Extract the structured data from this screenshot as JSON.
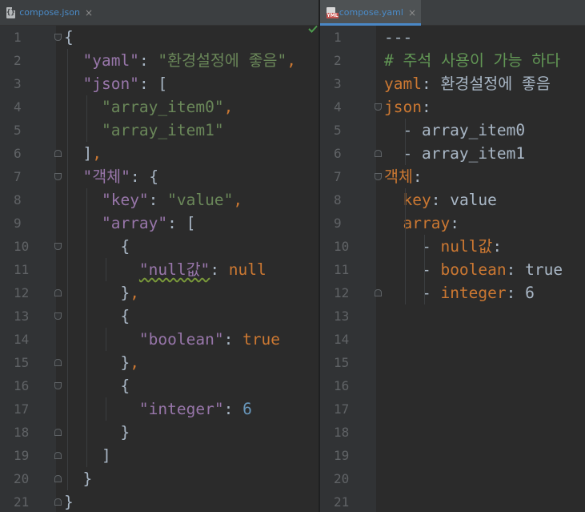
{
  "tabs": {
    "left": {
      "label": "compose.json",
      "icon": "json-file-icon",
      "close": "×"
    },
    "right": {
      "label": "compose.yaml",
      "icon": "yaml-file-icon",
      "close": "×",
      "active": true
    }
  },
  "left_editor": {
    "line_numbers": [
      "1",
      "2",
      "3",
      "4",
      "5",
      "6",
      "7",
      "8",
      "9",
      "10",
      "11",
      "12",
      "13",
      "14",
      "15",
      "16",
      "17",
      "18",
      "19",
      "20",
      "21"
    ],
    "lines": [
      [
        {
          "t": "p",
          "v": "{"
        }
      ],
      [
        {
          "t": "p",
          "v": "  "
        },
        {
          "t": "k",
          "v": "\"yaml\""
        },
        {
          "t": "p",
          "v": ": "
        },
        {
          "t": "s",
          "v": "\"환경설정에 좋음\""
        },
        {
          "t": "b",
          "v": ","
        }
      ],
      [
        {
          "t": "p",
          "v": "  "
        },
        {
          "t": "k",
          "v": "\"json\""
        },
        {
          "t": "p",
          "v": ": ["
        }
      ],
      [
        {
          "t": "p",
          "v": "    "
        },
        {
          "t": "s",
          "v": "\"array_item0\""
        },
        {
          "t": "b",
          "v": ","
        }
      ],
      [
        {
          "t": "p",
          "v": "    "
        },
        {
          "t": "s",
          "v": "\"array_item1\""
        }
      ],
      [
        {
          "t": "p",
          "v": "  ]"
        },
        {
          "t": "b",
          "v": ","
        }
      ],
      [
        {
          "t": "p",
          "v": "  "
        },
        {
          "t": "k",
          "v": "\"객체\""
        },
        {
          "t": "p",
          "v": ": {"
        }
      ],
      [
        {
          "t": "p",
          "v": "    "
        },
        {
          "t": "k",
          "v": "\"key\""
        },
        {
          "t": "p",
          "v": ": "
        },
        {
          "t": "s",
          "v": "\"value\""
        },
        {
          "t": "b",
          "v": ","
        }
      ],
      [
        {
          "t": "p",
          "v": "    "
        },
        {
          "t": "k",
          "v": "\"array\""
        },
        {
          "t": "p",
          "v": ": ["
        }
      ],
      [
        {
          "t": "p",
          "v": "      {"
        }
      ],
      [
        {
          "t": "p",
          "v": "        "
        },
        {
          "t": "k",
          "v": "\"null값\"",
          "u": true
        },
        {
          "t": "p",
          "v": ": "
        },
        {
          "t": "b",
          "v": "null"
        }
      ],
      [
        {
          "t": "p",
          "v": "      }"
        },
        {
          "t": "b",
          "v": ","
        }
      ],
      [
        {
          "t": "p",
          "v": "      {"
        }
      ],
      [
        {
          "t": "p",
          "v": "        "
        },
        {
          "t": "k",
          "v": "\"boolean\""
        },
        {
          "t": "p",
          "v": ": "
        },
        {
          "t": "b",
          "v": "true"
        }
      ],
      [
        {
          "t": "p",
          "v": "      }"
        },
        {
          "t": "b",
          "v": ","
        }
      ],
      [
        {
          "t": "p",
          "v": "      {"
        }
      ],
      [
        {
          "t": "p",
          "v": "        "
        },
        {
          "t": "k",
          "v": "\"integer\""
        },
        {
          "t": "p",
          "v": ": "
        },
        {
          "t": "n",
          "v": "6"
        }
      ],
      [
        {
          "t": "p",
          "v": "      }"
        }
      ],
      [
        {
          "t": "p",
          "v": "    ]"
        }
      ],
      [
        {
          "t": "p",
          "v": "  }"
        }
      ],
      [
        {
          "t": "p",
          "v": "}"
        }
      ]
    ]
  },
  "right_editor": {
    "line_numbers": [
      "1",
      "2",
      "3",
      "4",
      "5",
      "6",
      "7",
      "8",
      "9",
      "10",
      "11",
      "12",
      "13",
      "14",
      "15",
      "16",
      "17",
      "18",
      "19",
      "20",
      "21"
    ],
    "lines": [
      [
        {
          "t": "p",
          "v": "---"
        }
      ],
      [
        {
          "t": "y-c",
          "v": "# 주석 사용이 가능 하다"
        }
      ],
      [
        {
          "t": "y-key",
          "v": "yaml"
        },
        {
          "t": "p",
          "v": ": 환경설정에 좋음"
        }
      ],
      [
        {
          "t": "y-key",
          "v": "json"
        },
        {
          "t": "p",
          "v": ":"
        }
      ],
      [
        {
          "t": "p",
          "v": "  - array_item0"
        }
      ],
      [
        {
          "t": "p",
          "v": "  - array_item1"
        }
      ],
      [
        {
          "t": "y-key",
          "v": "객체"
        },
        {
          "t": "p",
          "v": ":"
        }
      ],
      [
        {
          "t": "p",
          "v": "  "
        },
        {
          "t": "y-key",
          "v": "key"
        },
        {
          "t": "p",
          "v": ": value"
        }
      ],
      [
        {
          "t": "p",
          "v": "  "
        },
        {
          "t": "y-key",
          "v": "array"
        },
        {
          "t": "p",
          "v": ":"
        }
      ],
      [
        {
          "t": "p",
          "v": "    - "
        },
        {
          "t": "y-key",
          "v": "null값"
        },
        {
          "t": "p",
          "v": ":"
        }
      ],
      [
        {
          "t": "p",
          "v": "    - "
        },
        {
          "t": "y-key",
          "v": "boolean"
        },
        {
          "t": "p",
          "v": ": true"
        }
      ],
      [
        {
          "t": "p",
          "v": "    - "
        },
        {
          "t": "y-key",
          "v": "integer"
        },
        {
          "t": "p",
          "v": ": 6"
        }
      ],
      [],
      [],
      [],
      [],
      [],
      [],
      [],
      [],
      []
    ]
  },
  "colors": {
    "background": "#2b2b2b",
    "gutter": "#313335",
    "json_key": "#9876aa",
    "json_string": "#6a8759",
    "keyword": "#cc7832",
    "number": "#6897bb",
    "comment": "#629755",
    "tab_active_underline": "#4a88c7"
  },
  "status": {
    "inspection_icon": "check-icon"
  }
}
